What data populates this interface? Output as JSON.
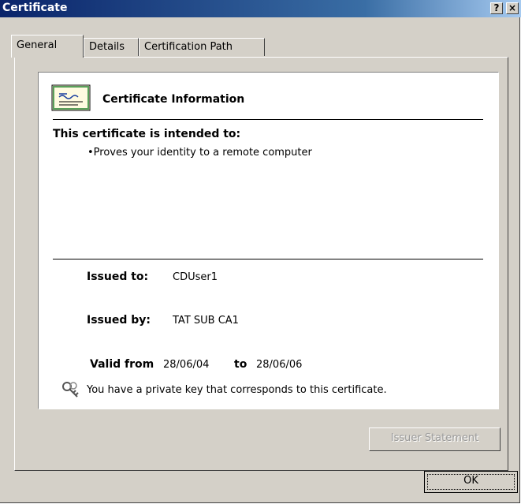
{
  "window": {
    "title": "Certificate",
    "help_button": "?",
    "close_button": "×"
  },
  "tabs": [
    {
      "label": "General",
      "active": true
    },
    {
      "label": "Details",
      "active": false
    },
    {
      "label": "Certification Path",
      "active": false
    }
  ],
  "info": {
    "heading": "Certificate Information",
    "purpose_title": "This certificate is intended to:",
    "purposes": [
      "•Proves your identity to a remote computer"
    ],
    "issued_to_label": "Issued to:",
    "issued_to_value": "CDUser1",
    "issued_by_label": "Issued by:",
    "issued_by_value": "TAT SUB CA1",
    "valid_from_label": "Valid from",
    "valid_from_value": "28/06/04",
    "valid_to_label": "to",
    "valid_to_value": "28/06/06",
    "private_key_note": "You have a private key that corresponds to this certificate."
  },
  "buttons": {
    "issuer_statement": "Issuer Statement",
    "ok": "OK"
  },
  "icons": {
    "certificate": "certificate-icon",
    "key": "key-icon"
  },
  "colors": {
    "titlebar_start": "#0a246a",
    "titlebar_end": "#a6caf0",
    "dialog_face": "#d4d0c8"
  }
}
